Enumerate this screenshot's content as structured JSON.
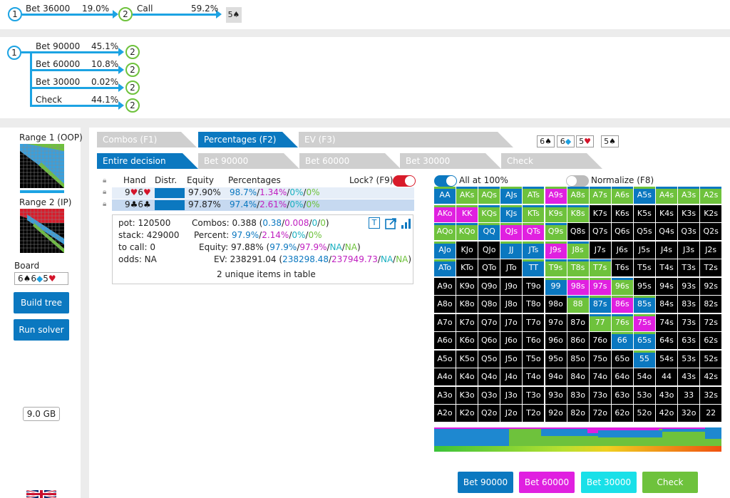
{
  "top_path": {
    "node1": "1",
    "action1": "Bet 36000",
    "pct1": "19.0%",
    "node2": "2",
    "action2": "Call",
    "pct2": "59.2%",
    "board_card": "5♠"
  },
  "tree": {
    "root": "1",
    "branches": [
      {
        "label": "Bet 90000",
        "pct": "45.1%",
        "node": "2"
      },
      {
        "label": "Bet 60000",
        "pct": "10.8%",
        "node": "2"
      },
      {
        "label": "Bet 30000",
        "pct": "0.02%",
        "node": "2"
      },
      {
        "label": "Check",
        "pct": "44.1%",
        "node": "2"
      }
    ]
  },
  "sidebar": {
    "range1_label": "Range 1 (OOP)",
    "range2_label": "Range 2 (IP)",
    "board_label": "Board",
    "board_value": "6♠6◆5♥",
    "build_tree": "Build tree",
    "run_solver": "Run solver",
    "memory": "9.0 GB"
  },
  "tabs_row1": [
    {
      "label": "Combos (F1)",
      "active": false
    },
    {
      "label": "Percentages (F2)",
      "active": true
    },
    {
      "label": "EV (F3)",
      "active": false
    }
  ],
  "tabs_row2": [
    {
      "label": "Entire decision",
      "active": true
    },
    {
      "label": "Bet 90000",
      "active": false
    },
    {
      "label": "Bet 60000",
      "active": false
    },
    {
      "label": "Bet 30000",
      "active": false
    },
    {
      "label": "Check",
      "active": false
    }
  ],
  "board_cards": [
    "6♠",
    "6◆",
    "5♥",
    "5♠"
  ],
  "hand_table": {
    "headers": {
      "hand": "Hand",
      "distr": "Distr.",
      "equity": "Equity",
      "percentages": "Percentages",
      "lock": "Lock? (F9)"
    },
    "rows": [
      {
        "hand_rank1": "9",
        "suit1": "♥",
        "hand_rank2": "6",
        "suit2": "♥",
        "suit": "h",
        "equity": "97.90%",
        "p1": "98.7%",
        "p2": "1.34%",
        "p3": "0%",
        "p4": "0%"
      },
      {
        "hand_rank1": "9",
        "suit1": "♣",
        "hand_rank2": "6",
        "suit2": "♣",
        "suit": "c",
        "equity": "97.87%",
        "p1": "97.4%",
        "p2": "2.61%",
        "p3": "0%",
        "p4": "0%"
      }
    ]
  },
  "stats": {
    "pot": "pot: 120500",
    "stack": "stack: 429000",
    "to_call": "to call: 0",
    "odds": "odds: NA",
    "combos_label": "Combos:",
    "combos_main": "0.388",
    "combos_parts": [
      "0.38",
      "0.008",
      "0",
      "0"
    ],
    "percent_label": "Percent:",
    "percent_parts": [
      "97.9%",
      "2.14%",
      "0%",
      "0%"
    ],
    "equity_label": "Equity:",
    "equity_main": "97.88%",
    "equity_parts": [
      "97.9%",
      "97.9%",
      "NA",
      "NA"
    ],
    "ev_label": "EV:",
    "ev_main": "238291.04",
    "ev_parts": [
      "238298.48",
      "237949.73",
      "NA",
      "NA"
    ],
    "unique": "2 unique items in table"
  },
  "toggles": {
    "all_100": "All at 100%",
    "normalize": "Normalize (F8)"
  },
  "grid": [
    [
      "AA",
      "AKs",
      "AQs",
      "AJs",
      "ATs",
      "A9s",
      "A8s",
      "A7s",
      "A6s",
      "A5s",
      "A4s",
      "A3s",
      "A2s"
    ],
    [
      "AKo",
      "KK",
      "KQs",
      "KJs",
      "KTs",
      "K9s",
      "K8s",
      "K7s",
      "K6s",
      "K5s",
      "K4s",
      "K3s",
      "K2s"
    ],
    [
      "AQo",
      "KQo",
      "QQ",
      "QJs",
      "QTs",
      "Q9s",
      "Q8s",
      "Q7s",
      "Q6s",
      "Q5s",
      "Q4s",
      "Q3s",
      "Q2s"
    ],
    [
      "AJo",
      "KJo",
      "QJo",
      "JJ",
      "JTs",
      "J9s",
      "J8s",
      "J7s",
      "J6s",
      "J5s",
      "J4s",
      "J3s",
      "J2s"
    ],
    [
      "ATo",
      "KTo",
      "QTo",
      "JTo",
      "TT",
      "T9s",
      "T8s",
      "T7s",
      "T6s",
      "T5s",
      "T4s",
      "T3s",
      "T2s"
    ],
    [
      "A9o",
      "K9o",
      "Q9o",
      "J9o",
      "T9o",
      "99",
      "98s",
      "97s",
      "96s",
      "95s",
      "94s",
      "93s",
      "92s"
    ],
    [
      "A8o",
      "K8o",
      "Q8o",
      "J8o",
      "T8o",
      "98o",
      "88",
      "87s",
      "86s",
      "85s",
      "84s",
      "83s",
      "82s"
    ],
    [
      "A7o",
      "K7o",
      "Q7o",
      "J7o",
      "T7o",
      "97o",
      "87o",
      "77",
      "76s",
      "75s",
      "74s",
      "73s",
      "72s"
    ],
    [
      "A6o",
      "K6o",
      "Q6o",
      "J6o",
      "T6o",
      "96o",
      "86o",
      "76o",
      "66",
      "65s",
      "64s",
      "63s",
      "62s"
    ],
    [
      "A5o",
      "K5o",
      "Q5o",
      "J5o",
      "T5o",
      "95o",
      "85o",
      "75o",
      "65o",
      "55",
      "54s",
      "53s",
      "52s"
    ],
    [
      "A4o",
      "K4o",
      "Q4o",
      "J4o",
      "T4o",
      "94o",
      "84o",
      "74o",
      "64o",
      "54o",
      "44",
      "43s",
      "42s"
    ],
    [
      "A3o",
      "K3o",
      "Q3o",
      "J3o",
      "T3o",
      "93o",
      "83o",
      "73o",
      "63o",
      "53o",
      "43o",
      "33",
      "32s"
    ],
    [
      "A2o",
      "K2o",
      "Q2o",
      "J2o",
      "T2o",
      "92o",
      "82o",
      "72o",
      "62o",
      "52o",
      "42o",
      "32o",
      "22"
    ]
  ],
  "cell_colors": [
    [
      "b",
      "g",
      "g",
      "b",
      "g",
      "m",
      "g",
      "g",
      "g",
      "b",
      "g",
      "g",
      "g"
    ],
    [
      "m",
      "m",
      "g",
      "b",
      "g",
      "g",
      "g",
      "k",
      "k",
      "k",
      "k",
      "k",
      "k"
    ],
    [
      "g",
      "g",
      "b",
      "m",
      "m",
      "g",
      "k",
      "k",
      "k",
      "k",
      "k",
      "k",
      "k"
    ],
    [
      "b",
      "k",
      "k",
      "b",
      "b",
      "m",
      "g",
      "k",
      "k",
      "k",
      "k",
      "k",
      "k"
    ],
    [
      "b",
      "k",
      "k",
      "k",
      "b",
      "g",
      "g",
      "g",
      "k",
      "k",
      "k",
      "k",
      "k"
    ],
    [
      "k",
      "k",
      "k",
      "k",
      "k",
      "b",
      "m",
      "m",
      "g",
      "k",
      "k",
      "k",
      "k"
    ],
    [
      "k",
      "k",
      "k",
      "k",
      "k",
      "k",
      "g",
      "b",
      "m",
      "b",
      "k",
      "k",
      "k"
    ],
    [
      "k",
      "k",
      "k",
      "k",
      "k",
      "k",
      "k",
      "g",
      "g",
      "m",
      "k",
      "k",
      "k"
    ],
    [
      "k",
      "k",
      "k",
      "k",
      "k",
      "k",
      "k",
      "k",
      "b",
      "b",
      "k",
      "k",
      "k"
    ],
    [
      "k",
      "k",
      "k",
      "k",
      "k",
      "k",
      "k",
      "k",
      "k",
      "b",
      "k",
      "k",
      "k"
    ],
    [
      "k",
      "k",
      "k",
      "k",
      "k",
      "k",
      "k",
      "k",
      "k",
      "k",
      "k",
      "k",
      "k"
    ],
    [
      "k",
      "k",
      "k",
      "k",
      "k",
      "k",
      "k",
      "k",
      "k",
      "k",
      "k",
      "k",
      "k"
    ],
    [
      "k",
      "k",
      "k",
      "k",
      "k",
      "k",
      "k",
      "k",
      "k",
      "k",
      "k",
      "k",
      "k"
    ]
  ],
  "colors": {
    "bet90": "#0b78c0",
    "bet60": "#e020e0",
    "bet30": "#19e0e8",
    "check": "#6ec23c",
    "blank": "#000000",
    "accent": "#1ca3e3"
  },
  "action_buttons": [
    {
      "label": "Bet 90000",
      "color": "#0b78c0"
    },
    {
      "label": "Bet 60000",
      "color": "#e020e0"
    },
    {
      "label": "Bet 30000",
      "color": "#19e0e8"
    },
    {
      "label": "Check",
      "color": "#6ec23c"
    }
  ]
}
